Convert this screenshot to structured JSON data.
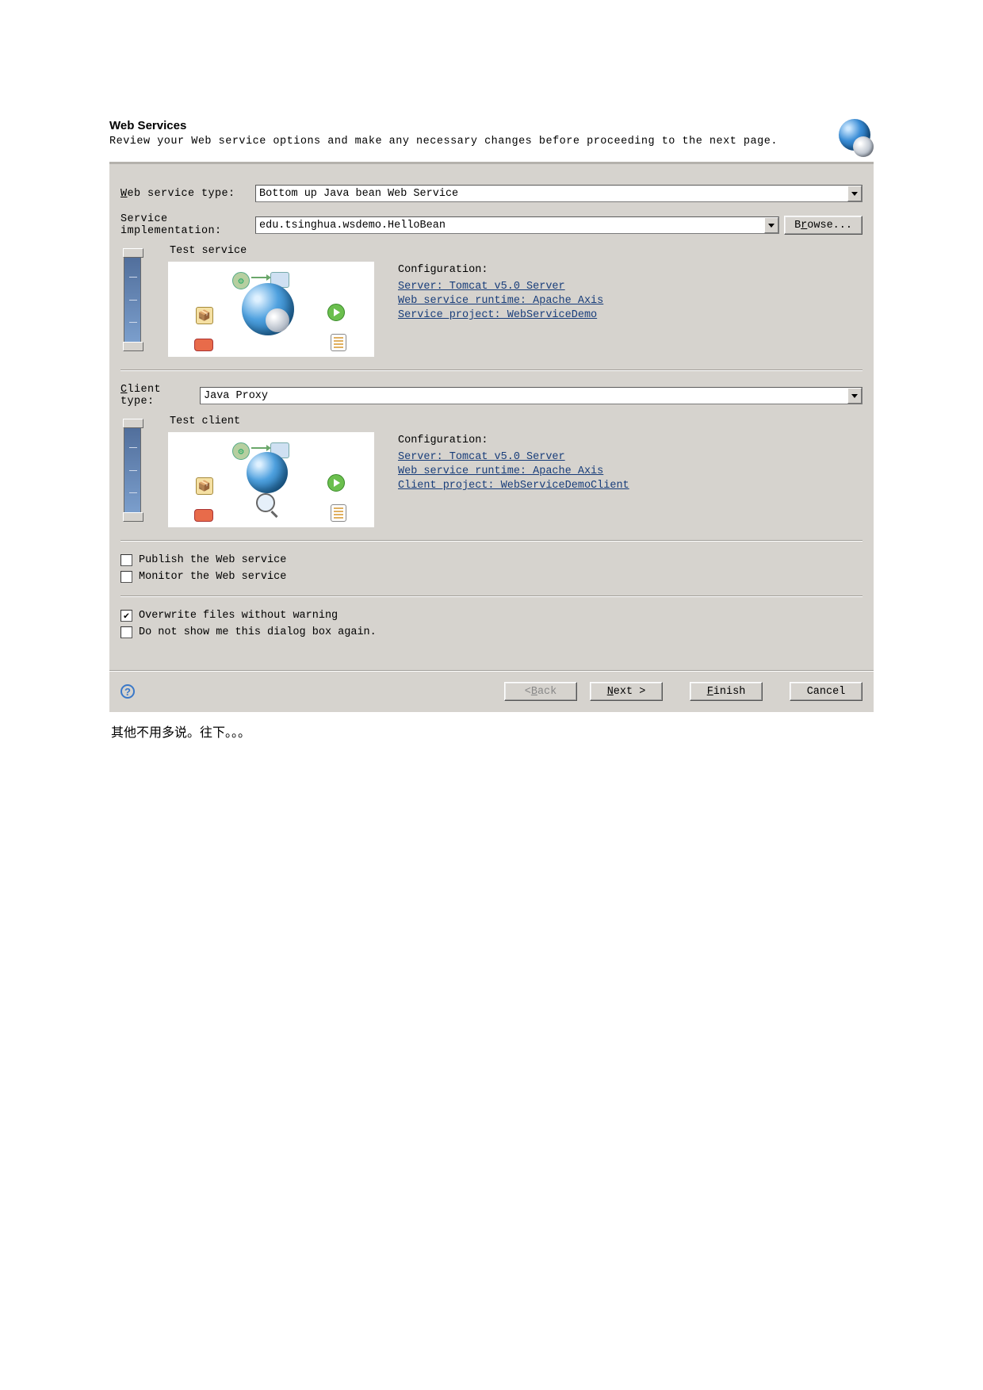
{
  "header": {
    "title": "Web Services",
    "subtitle": "Review your Web service options and make any necessary changes before proceeding to the next page."
  },
  "rows": {
    "type_label_pre": "W",
    "type_label_post": "eb service type:",
    "type_value": "Bottom up Java bean Web Service",
    "impl_label": "Service implementation:",
    "impl_value": "edu.tsinghua.wsdemo.HelloBean",
    "browse_pre": "B",
    "browse_u": "r",
    "browse_post": "owse...",
    "client_label_pre": "C",
    "client_label_post": "lient type:",
    "client_value": "Java Proxy"
  },
  "service": {
    "diagram_title": "Test service",
    "cfg_title": "Configuration:",
    "server_link": "Server: Tomcat v5.0 Server",
    "runtime_link": "Web service runtime: Apache Axis",
    "project_link": "Service project: WebServiceDemo"
  },
  "client": {
    "diagram_title": "Test client",
    "cfg_title": "Configuration:",
    "server_link": "Server: Tomcat v5.0 Server",
    "runtime_link": "Web service runtime: Apache Axis",
    "project_link": "Client project: WebServiceDemoClient"
  },
  "checks": {
    "publish_u": "P",
    "publish_post": "ublish the Web service",
    "monitor_u": "M",
    "monitor_post": "onitor the Web service",
    "overwrite_u": "O",
    "overwrite_post": "verwrite files without warning",
    "noshow": "Do not show me this dialog box again."
  },
  "buttons": {
    "back_lt": "< ",
    "back_u": "B",
    "back_post": "ack",
    "next_u": "N",
    "next_post": "ext >",
    "finish_u": "F",
    "finish_post": "inish",
    "cancel": "Cancel"
  },
  "caption": "其他不用多说。往下。。。"
}
